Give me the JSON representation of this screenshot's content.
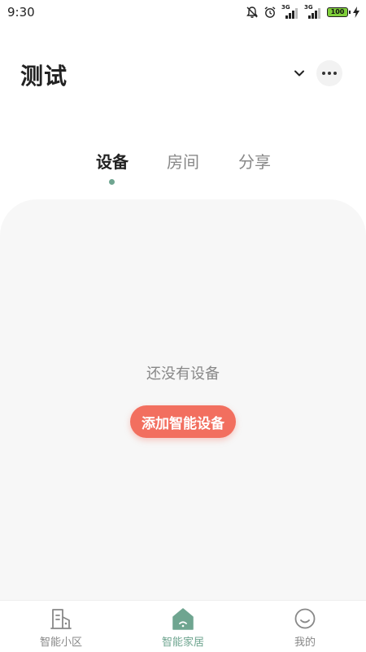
{
  "status_bar": {
    "time": "9:30",
    "signal1_label": "3G",
    "signal2_label": "3G",
    "battery": "100"
  },
  "header": {
    "home_name": "测试"
  },
  "tabs": [
    {
      "label": "设备",
      "active": true
    },
    {
      "label": "房间",
      "active": false
    },
    {
      "label": "分享",
      "active": false
    }
  ],
  "content": {
    "empty_text": "还没有设备",
    "add_button": "添加智能设备"
  },
  "bottom_nav": [
    {
      "label": "智能小区",
      "icon": "building-icon",
      "active": false
    },
    {
      "label": "智能家居",
      "icon": "home-icon",
      "active": true
    },
    {
      "label": "我的",
      "icon": "smile-icon",
      "active": false
    }
  ],
  "colors": {
    "accent": "#6fa590",
    "primary_button": "#f26f5f",
    "panel_bg": "#f7f7f7"
  }
}
